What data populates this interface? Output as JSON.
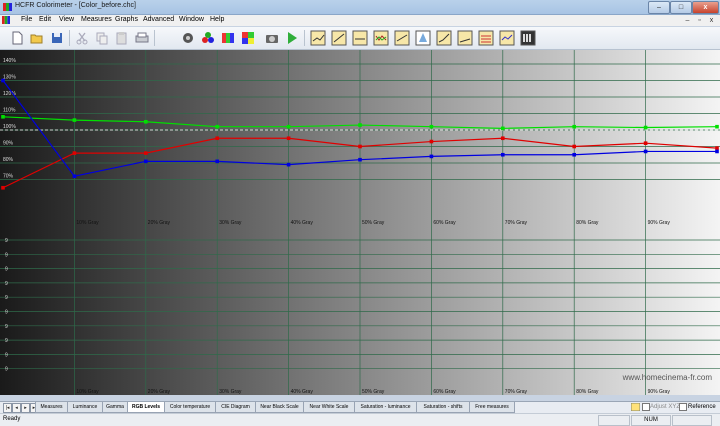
{
  "window": {
    "title": "HCFR Colorimeter - [Color_before.chc]",
    "min_label": "–",
    "max_label": "□",
    "close_label": "x"
  },
  "menu": {
    "items": [
      "File",
      "Edit",
      "View",
      "Measures",
      "Graphs",
      "Advanced",
      "Window",
      "Help"
    ],
    "mdi_min": "–",
    "mdi_restore": "▫",
    "mdi_close": "x"
  },
  "toolbar": {
    "icons": [
      "new-document-icon",
      "open-folder-icon",
      "save-icon",
      "cut-icon",
      "copy-icon",
      "paste-icon",
      "print-icon",
      "sensor-icon",
      "rgb-spheres-icon",
      "color-pattern-icon",
      "color-cube-icon",
      "camera-icon",
      "run-measure-icon",
      "view-mode-1-icon",
      "view-mode-2-icon",
      "view-mode-3-icon",
      "view-mode-4-icon",
      "view-mode-5-icon",
      "view-mode-6-icon",
      "view-mode-7-icon",
      "view-mode-8-icon",
      "view-mode-9-icon",
      "view-mode-10-icon",
      "view-mode-11-icon"
    ]
  },
  "chart_data": {
    "type": "line",
    "title": "",
    "x": [
      0,
      10,
      20,
      30,
      40,
      50,
      60,
      70,
      80,
      90,
      100
    ],
    "xlim": [
      0,
      100
    ],
    "ylim_top_panel": [
      70,
      140
    ],
    "top_y_ticks": [
      "140%",
      "130%",
      "120%",
      "110%",
      "100%",
      "90%",
      "80%",
      "70%"
    ],
    "category_labels": [
      "10% Gray",
      "20% Gray",
      "30% Gray",
      "40% Gray",
      "50% Gray",
      "60% Gray",
      "70% Gray",
      "80% Gray",
      "90% Gray"
    ],
    "lower_y_ticks": [
      "9",
      "9",
      "9",
      "9",
      "9",
      "9",
      "9",
      "9",
      "9",
      "9"
    ],
    "reference_line": 100,
    "series": [
      {
        "color": "#00e000",
        "values": [
          108,
          106,
          105,
          102,
          102,
          103,
          102,
          101,
          102,
          101.5,
          102
        ]
      },
      {
        "color": "#e00000",
        "values": [
          65,
          86,
          86,
          95,
          95,
          90,
          93,
          95,
          90,
          92,
          89
        ]
      },
      {
        "color": "#0000e0",
        "values": [
          130,
          72,
          81,
          81,
          79,
          82,
          84,
          85,
          85,
          87,
          87
        ]
      }
    ],
    "grid": true,
    "watermark": "www.homecinema-fr.com"
  },
  "tabs": {
    "items": [
      "Measures",
      "Luminance",
      "Gamma",
      "RGB Levels",
      "Color temperature",
      "CIE Diagram",
      "Near Black Scale",
      "Near White Scale",
      "Saturation - luminance",
      "Saturation - shifts",
      "Free measures"
    ],
    "active_index": 3
  },
  "options": {
    "adjust_xyz": "Adjust XYZ",
    "reference": "Reference"
  },
  "status": {
    "ready": "Ready",
    "num": "NUM"
  }
}
